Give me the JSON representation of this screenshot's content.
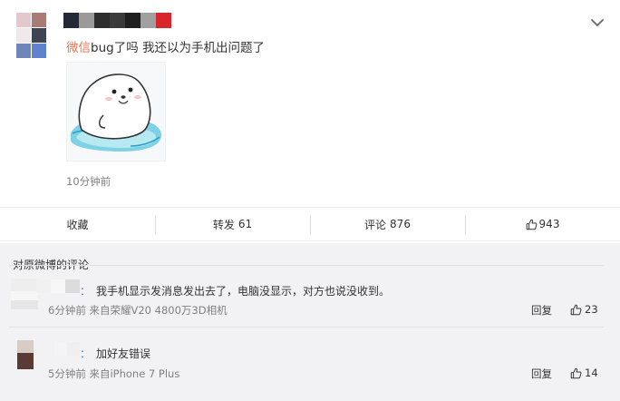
{
  "post": {
    "text_highlight": "微信",
    "text_rest": "bug了吗 我还以为手机出问题了",
    "time": "10分钟前",
    "image_icon": "seal-sticker"
  },
  "actions": {
    "favorite_label": "收藏",
    "repost_label": "转发",
    "repost_count": "61",
    "comment_label": "评论",
    "comment_count": "876",
    "like_count": "943"
  },
  "comments": {
    "section_title": "对原微博的评论",
    "items": [
      {
        "prefix": "：",
        "text": "我手机显示发消息发出去了，电脑没显示，对方也说没收到。",
        "meta": "6分钟前 来自荣耀V20 4800万3D相机",
        "reply_label": "回复",
        "like_count": "23"
      },
      {
        "prefix": "：",
        "text": "加好友错误",
        "meta": "5分钟前 来自iPhone 7 Plus",
        "reply_label": "回复",
        "like_count": "14"
      }
    ]
  },
  "colors": {
    "highlight": "#eb7350",
    "comments_bg": "#f2f2f5",
    "muted_text": "#808080"
  }
}
